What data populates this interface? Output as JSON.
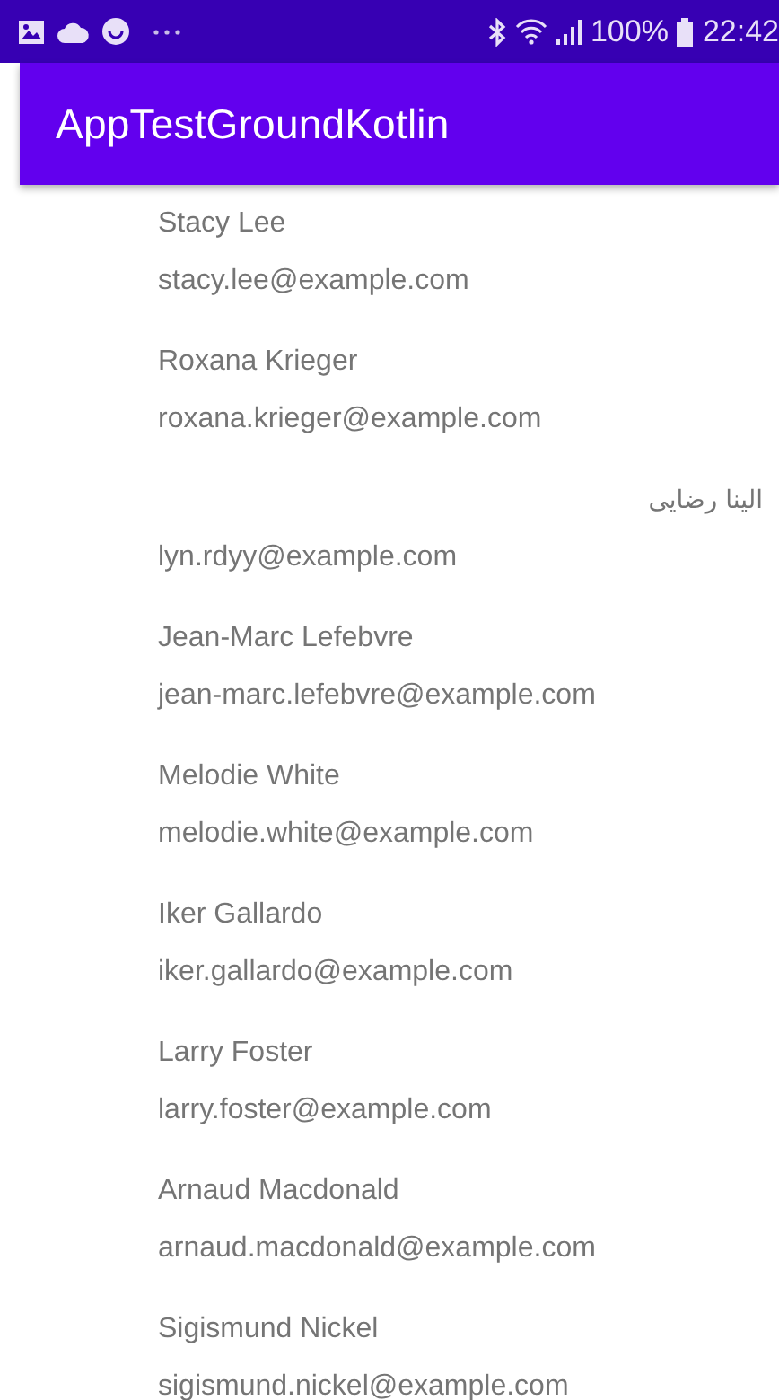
{
  "status_bar": {
    "battery": "100%",
    "time": "22:42"
  },
  "app_bar": {
    "title": "AppTestGroundKotlin"
  },
  "contacts": [
    {
      "name": "Stacy Lee",
      "email": "stacy.lee@example.com",
      "right_to_left": false
    },
    {
      "name": "Roxana Krieger",
      "email": "roxana.krieger@example.com",
      "right_to_left": false
    },
    {
      "name": "الينا رضایی",
      "email": "lyn.rdyy@example.com",
      "right_to_left": true
    },
    {
      "name": "Jean-Marc Lefebvre",
      "email": "jean-marc.lefebvre@example.com",
      "right_to_left": false
    },
    {
      "name": "Melodie White",
      "email": "melodie.white@example.com",
      "right_to_left": false
    },
    {
      "name": "Iker Gallardo",
      "email": "iker.gallardo@example.com",
      "right_to_left": false
    },
    {
      "name": "Larry Foster",
      "email": "larry.foster@example.com",
      "right_to_left": false
    },
    {
      "name": "Arnaud Macdonald",
      "email": "arnaud.macdonald@example.com",
      "right_to_left": false
    },
    {
      "name": "Sigismund Nickel",
      "email": "sigismund.nickel@example.com",
      "right_to_left": false
    }
  ]
}
